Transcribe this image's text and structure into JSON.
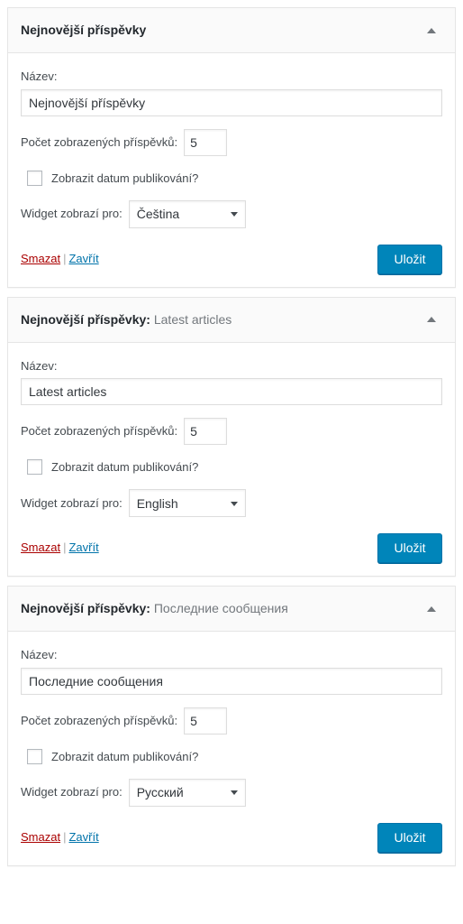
{
  "labels": {
    "title_label": "Název:",
    "count_label": "Počet zobrazených příspěvků:",
    "show_date_label": "Zobrazit datum publikování?",
    "language_label": "Widget zobrazí pro:",
    "delete_link": "Smazat",
    "separator": "|",
    "close_link": "Zavřít",
    "save_button": "Uložit",
    "collapse_icon": "caret-up-icon"
  },
  "colors": {
    "accent": "#0085ba",
    "accent_border": "#0073aa",
    "delete_link": "#a00",
    "close_link": "#0073aa",
    "panel_border": "#e5e5e5",
    "panel_header_bg": "#fafafa",
    "title_dark": "#23282d",
    "title_light": "#72777c"
  },
  "language_options": [
    "Čeština",
    "English",
    "Русский"
  ],
  "widgets": [
    {
      "base_name": "Nejnovější příspěvky",
      "instance_name": "",
      "header_suffix": "",
      "title_value": "Nejnovější příspěvky",
      "count_value": "5",
      "show_date_checked": false,
      "language_value": "Čeština"
    },
    {
      "base_name": "Nejnovější příspěvky",
      "instance_name": "Latest articles",
      "header_suffix": ":",
      "title_value": "Latest articles",
      "count_value": "5",
      "show_date_checked": false,
      "language_value": "English"
    },
    {
      "base_name": "Nejnovější příspěvky",
      "instance_name": "Последние сообщения",
      "header_suffix": ":",
      "title_value": "Последние сообщения",
      "count_value": "5",
      "show_date_checked": false,
      "language_value": "Русский"
    }
  ]
}
